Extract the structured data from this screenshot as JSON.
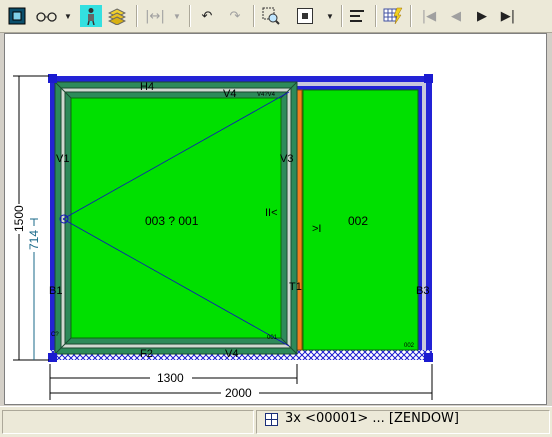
{
  "toolbar": {
    "buttons": [
      {
        "name": "view-mode-icon"
      },
      {
        "name": "glasses-icon"
      },
      {
        "name": "person-icon"
      },
      {
        "name": "layers-icon"
      },
      {
        "name": "dimension-icon"
      },
      {
        "name": "undo-icon"
      },
      {
        "name": "redo-icon"
      },
      {
        "name": "zoom-select-icon"
      },
      {
        "name": "frame-select-icon"
      },
      {
        "name": "align-icon"
      },
      {
        "name": "grid-lightning-icon"
      },
      {
        "name": "first-record-icon"
      },
      {
        "name": "previous-record-icon"
      },
      {
        "name": "next-record-icon"
      },
      {
        "name": "last-record-icon"
      }
    ]
  },
  "drawing": {
    "labels": {
      "top_rail": "H4",
      "v4": "V4",
      "v4b": "V4?V4",
      "v1": "V1",
      "v3": "V3",
      "b1": "B1",
      "t1": "T1",
      "b3": "B3",
      "f2": "F2",
      "v4_bottom": "V4",
      "sash_text": "003 ? 001",
      "fixed_text": "002",
      "hinge_mark": "II<",
      "fixed_mark": ">I",
      "small_001": "001",
      "small_002": "002",
      "small_cn": "C?"
    },
    "dimensions": {
      "width_sash": "1300",
      "width_total": "2000",
      "height_total": "1500",
      "handle_height": "714"
    }
  },
  "status": {
    "text": "3x <00001> ... [ZENDOW]"
  }
}
